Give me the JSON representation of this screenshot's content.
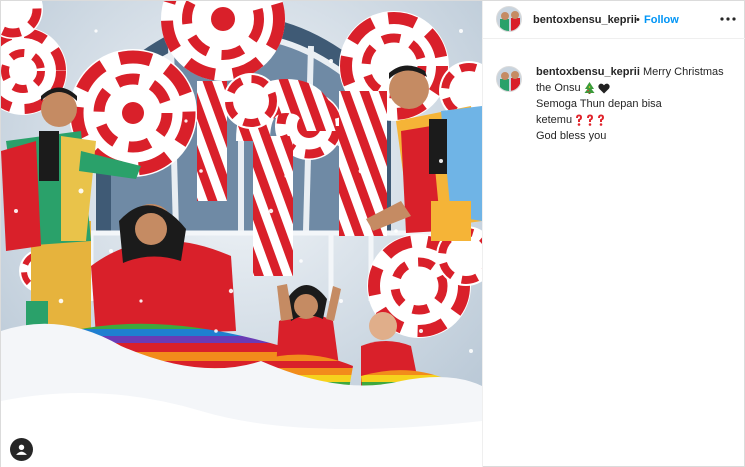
{
  "post": {
    "username": "bentoxbensu_keprii",
    "separator": "•",
    "follow_label": "Follow",
    "more_icon": "more-horizontal-icon",
    "user_tag_icon": "user-tag-icon"
  },
  "caption": {
    "username": "bentoxbensu_keprii",
    "line1": "Merry Christmas",
    "line2": "the Onsu",
    "line3": "Semoga Thun depan bisa",
    "line4": "ketemu",
    "line5": "God bless you",
    "emojis": [
      "christmas-tree-icon",
      "black-heart-icon",
      "red-question-mark-icon"
    ]
  },
  "colors": {
    "link_blue": "#0095f6",
    "text": "#262626",
    "border": "#efefef"
  }
}
